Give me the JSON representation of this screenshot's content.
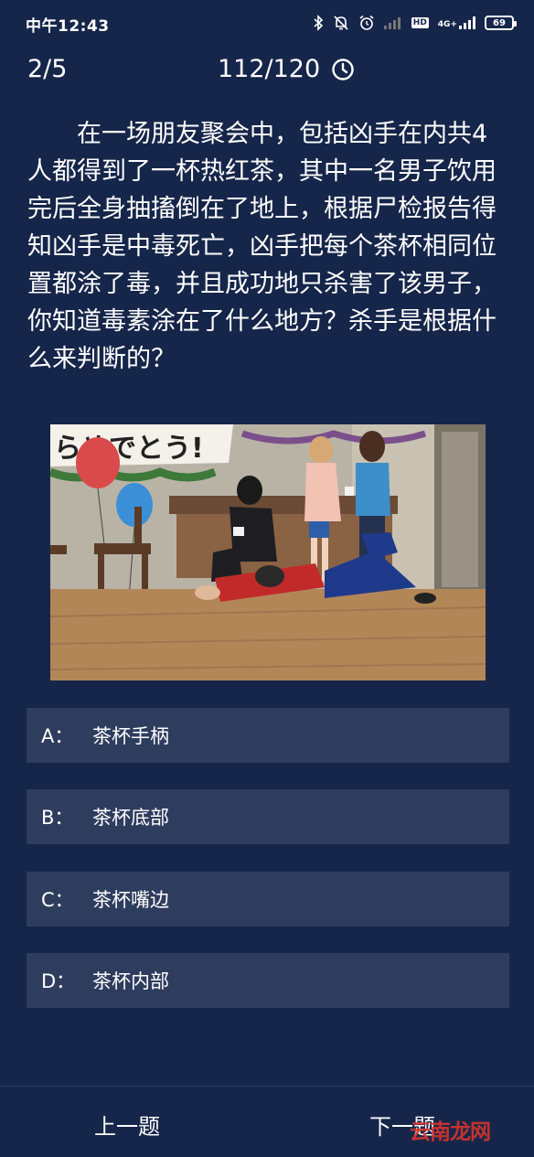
{
  "status_bar": {
    "time": "中午12:43",
    "network": "4G+",
    "battery": "69"
  },
  "header": {
    "progress": "2/5",
    "timer": "112/120",
    "timer_icon": "clock-icon"
  },
  "question": {
    "text": "在一场朋友聚会中，包括凶手在内共4人都得到了一杯热红茶，其中一名男子饮用完后全身抽搐倒在了地上，根据尸检报告得知凶手是中毒死亡，凶手把每个茶杯相同位置都涂了毒，并且成功地只杀害了该男子，你知道毒素涂在了什么地方？杀手是根据什么来判断的？",
    "image_banner": "らめでとう!"
  },
  "options": [
    {
      "letter": "A：",
      "text": "茶杯手柄"
    },
    {
      "letter": "B：",
      "text": "茶杯底部"
    },
    {
      "letter": "C：",
      "text": "茶杯嘴边"
    },
    {
      "letter": "D：",
      "text": "茶杯内部"
    }
  ],
  "nav": {
    "prev": "上一题",
    "next": "下一题"
  },
  "watermark": "云南龙网",
  "colors": {
    "background": "#16264a",
    "option_background": "#2e3d5e",
    "text": "#ffffff",
    "watermark": "#d9342b"
  }
}
